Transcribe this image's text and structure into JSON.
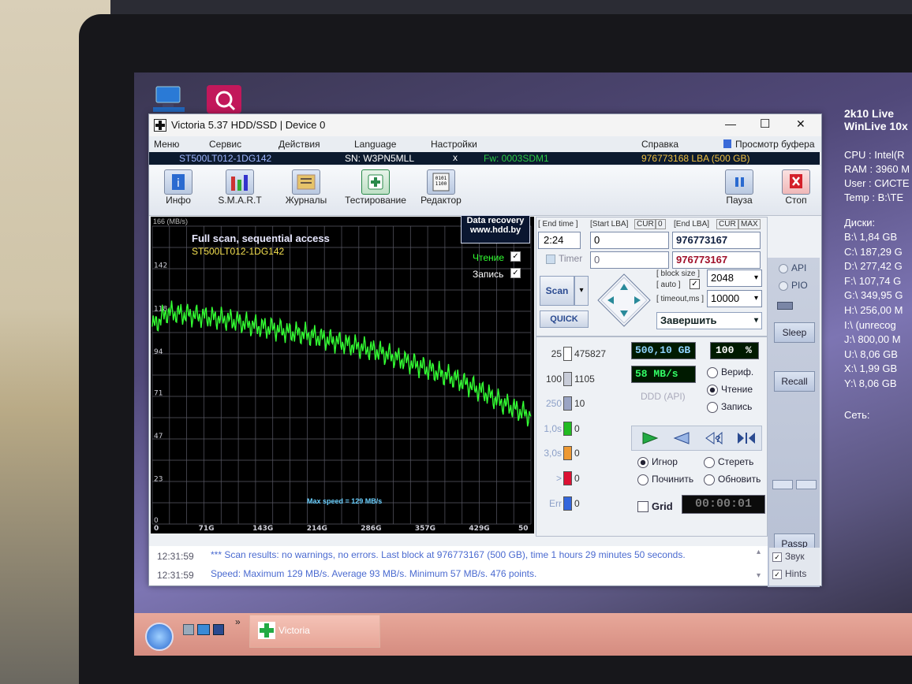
{
  "window": {
    "title": "Victoria 5.37 HDD/SSD | Device 0",
    "minimize": "—",
    "maximize": "☐",
    "close": "✕"
  },
  "menu": {
    "items": [
      "Меню",
      "Сервис",
      "Действия",
      "Language",
      "Настройки"
    ],
    "help": "Справка",
    "buffer": "Просмотр буфера"
  },
  "device": {
    "model": "ST500LT012-1DG142",
    "serial": "SN: W3PN5MLL",
    "close": "x",
    "firmware": "Fw: 0003SDM1",
    "lba": "976773168 LBA (500 GB)"
  },
  "toolbar": {
    "info": "Инфо",
    "smart": "S.M.A.R.T",
    "logs": "Журналы",
    "testing": "Тестирование",
    "editor": "Редактор",
    "pause": "Пауза",
    "stop": "Стоп"
  },
  "chart": {
    "title": "Full scan, sequential access",
    "model": "ST500LT012-1DG142",
    "banner_line1": "Data recovery",
    "banner_line2": "www.hdd.by",
    "unit": "166 (MB/s)",
    "read_label": "Чтение",
    "write_label": "Запись",
    "max_speed": "Max speed = 129 MB/s"
  },
  "chart_data": {
    "type": "line",
    "xlabel": "",
    "ylabel": "",
    "y_ticks": [
      "142",
      "118",
      "94",
      "71",
      "47",
      "23",
      "0"
    ],
    "x_ticks": [
      "0",
      "71G",
      "143G",
      "214G",
      "286G",
      "357G",
      "429G",
      "50"
    ],
    "ylim": [
      0,
      166
    ],
    "xlim": [
      0,
      500
    ],
    "grid": true,
    "series": [
      {
        "name": "Чтение",
        "color": "#33ff33",
        "x": [
          0,
          20,
          40,
          60,
          80,
          100,
          120,
          140,
          160,
          180,
          200,
          220,
          240,
          260,
          280,
          300,
          320,
          340,
          360,
          380,
          400,
          420,
          440,
          460,
          480,
          500
        ],
        "values": [
          110,
          118,
          117,
          116,
          115,
          114,
          112,
          110,
          109,
          107,
          106,
          104,
          102,
          100,
          98,
          96,
          93,
          90,
          87,
          84,
          81,
          77,
          73,
          68,
          64,
          60
        ]
      }
    ]
  },
  "scan": {
    "end_time_label": "[ End time ]",
    "end_time": "2:24",
    "timer_label": "Timer",
    "start_lba_label": "[Start LBA]",
    "cur": "CUR",
    "zero": "0",
    "start_lba": "0",
    "start_lba2": "0",
    "end_lba_label": "[End LBA]",
    "max": "MAX",
    "end_lba": "976773167",
    "end_lba2": "976773167",
    "scan_btn": "Scan",
    "quick_btn": "QUICK",
    "block_size_label": "[ block size ]",
    "auto_label": "[ auto ]",
    "timeout_label": "[ timeout,ms ]",
    "block_size": "2048",
    "timeout": "10000",
    "finish": "Завершить"
  },
  "stats": {
    "blocks": [
      {
        "label": "25",
        "count": "475827",
        "color": "#ffffff"
      },
      {
        "label": "100",
        "count": "1105",
        "color": "#c8ccd8"
      },
      {
        "label": "250",
        "count": "10",
        "color": "#9aa4c4"
      },
      {
        "label": "1,0s",
        "count": "0",
        "color": "#22bb22"
      },
      {
        "label": "3,0s",
        "count": "0",
        "color": "#ee9933"
      },
      {
        "label": ">",
        "count": "0",
        "color": "#dd1133"
      },
      {
        "label": "Err",
        "count": "0",
        "color": "#3366dd"
      }
    ],
    "size": "500,10 GB",
    "percent": "100",
    "percent_unit": "%",
    "speed": "58 MB/s",
    "ddd": "DDD (API)",
    "verify": "Вериф.",
    "read": "Чтение",
    "write": "Запись",
    "ignore": "Игнор",
    "erase": "Стереть",
    "repair": "Починить",
    "refresh": "Обновить",
    "grid": "Grid",
    "timer": "00:00:01"
  },
  "side": {
    "api": "API",
    "pio": "PIO",
    "sleep": "Sleep",
    "recall": "Recall",
    "passp": "Passp",
    "sound": "Звук",
    "hints": "Hints"
  },
  "log": {
    "rows": [
      {
        "time": "12:31:59",
        "text": "*** Scan results: no warnings, no errors. Last block at 976773167 (500 GB), time 1 hours 29 minutes 50 seconds."
      },
      {
        "time": "12:31:59",
        "text": "Speed: Maximum 129 MB/s. Average 93 MB/s. Minimum 57 MB/s. 476 points."
      }
    ]
  },
  "taskbar": {
    "app": "Victoria",
    "chevron": "»"
  },
  "sysinfo": {
    "title1": "2k10 Live",
    "title2": "WinLive 10x",
    "lines": [
      "CPU : Intel(R",
      "RAM : 3960 M",
      "User : СИСТЕ",
      "Temp : B:\\TE"
    ],
    "disks_title": "Диски:",
    "disks": [
      "B:\\ 1,84 GB",
      "C:\\ 187,29 G",
      "D:\\ 277,42 G",
      "F:\\ 107,74 G",
      "G:\\ 349,95 G",
      "H:\\ 256,00 M",
      "I:\\ (unrecog",
      "J:\\ 800,00 M",
      "U:\\ 8,06 GB",
      "X:\\ 1,99 GB",
      "Y:\\ 8,06 GB"
    ],
    "network": "Сеть:"
  }
}
